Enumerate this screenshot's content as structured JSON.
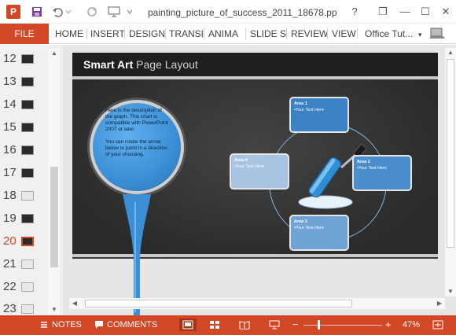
{
  "app": {
    "title": "painting_picture_of_success_2011_18678.pp...",
    "logo": "P",
    "help": "?",
    "restore": "❐",
    "minimize": "—",
    "maximize": "☐",
    "close": "✕"
  },
  "ribbon": {
    "file": "FILE",
    "tabs": [
      "HOME",
      "INSERT",
      "DESIGN",
      "TRANSI",
      "ANIMA",
      "SLIDE S",
      "REVIEW",
      "VIEW"
    ],
    "account": "Office Tut...",
    "account_caret": "▾"
  },
  "thumbnails": {
    "items": [
      {
        "num": "12",
        "dark": true
      },
      {
        "num": "13",
        "dark": true
      },
      {
        "num": "14",
        "dark": true
      },
      {
        "num": "15",
        "dark": true
      },
      {
        "num": "16",
        "dark": true
      },
      {
        "num": "17",
        "dark": true
      },
      {
        "num": "18",
        "dark": false
      },
      {
        "num": "19",
        "dark": true
      },
      {
        "num": "20",
        "dark": true,
        "active": true
      },
      {
        "num": "21",
        "dark": false
      },
      {
        "num": "22",
        "dark": false
      },
      {
        "num": "23",
        "dark": false
      }
    ]
  },
  "slide": {
    "title_bold": "Smart Art",
    "title_thin": "Page Layout",
    "circle_text_1": "Here is the description of the graph. This chart is compatible with PowerPoint 2007 or later.",
    "circle_text_2": "You can rotate the arrow below to point in a direction of your choosing.",
    "nodes": [
      {
        "title": "Area 1",
        "text": "•Your Text Here"
      },
      {
        "title": "Area 2",
        "text": "•Your Text Here"
      },
      {
        "title": "Area 4",
        "text": "•Your Text Here"
      },
      {
        "title": "Area 3",
        "text": "•Your Text Here"
      }
    ]
  },
  "status": {
    "notes": "NOTES",
    "comments": "COMMENTS",
    "zoom_minus": "−",
    "zoom_plus": "+",
    "zoom": "47%"
  },
  "colors": {
    "accent": "#d24726",
    "slide_bg": "#2f2f2f",
    "paint_blue": "#3b8fd4"
  }
}
